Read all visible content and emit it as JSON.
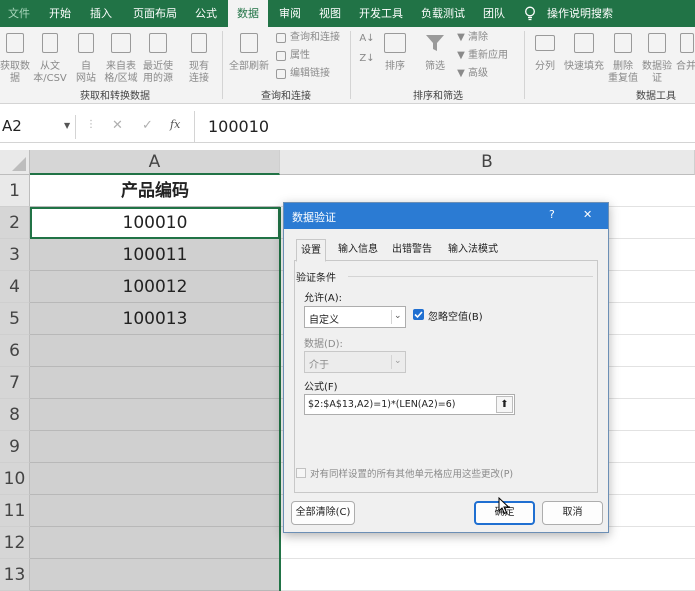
{
  "ribbon_tabs": [
    "文件",
    "开始",
    "插入",
    "页面布局",
    "公式",
    "数据",
    "审阅",
    "视图",
    "开发工具",
    "负载测试",
    "团队",
    "操作说明搜索"
  ],
  "active_tab": "数据",
  "ribbon": {
    "get_data": [
      "获取数",
      "据"
    ],
    "from_csv": [
      "从文",
      "本/CSV"
    ],
    "from_web": [
      "自",
      "网站"
    ],
    "from_table": [
      "来自表",
      "格/区域"
    ],
    "recent_sources": [
      "最近使",
      "用的源"
    ],
    "existing_conn": [
      "现有",
      "连接"
    ],
    "group1_label": "获取和转换数据",
    "refresh_all": [
      "全部刷新"
    ],
    "queries_conn": "查询和连接",
    "properties": "属性",
    "edit_links": "编辑链接",
    "group2_label": "查询和连接",
    "sort": "排序",
    "filter": "筛选",
    "clear": "清除",
    "reapply": "重新应用",
    "advanced": "高级",
    "group3_label": "排序和筛选",
    "text_to_columns": "分列",
    "flash_fill": "快速填充",
    "remove_dup": [
      "删除",
      "重复值"
    ],
    "data_validation": [
      "数据验",
      "证"
    ],
    "consolidate": "合并",
    "group4_label": "数据工具"
  },
  "formula_bar": {
    "name_box": "A2",
    "fx": "fx",
    "value": "100010"
  },
  "sheet": {
    "col_headers": [
      "A",
      "B"
    ],
    "row_numbers": [
      "1",
      "2",
      "3",
      "4",
      "5",
      "6",
      "7",
      "8",
      "9",
      "10",
      "11",
      "12",
      "13"
    ],
    "a_values": [
      "产品编码",
      "100010",
      "100011",
      "100012",
      "100013",
      "",
      "",
      "",
      "",
      "",
      "",
      "",
      ""
    ]
  },
  "dialog": {
    "title": "数据验证",
    "help": "?",
    "close": "✕",
    "tabs": [
      "设置",
      "输入信息",
      "出错警告",
      "输入法模式"
    ],
    "section": "验证条件",
    "allow_label": "允许(A):",
    "allow_value": "自定义",
    "ignore_blank": "忽略空值(B)",
    "data_label": "数据(D):",
    "data_value": "介于",
    "formula_label": "公式(F)",
    "formula_value": "$2:$A$13,A2)=1)*(LEN(A2)=6)",
    "apply_all": "对有同样设置的所有其他单元格应用这些更改(P)",
    "clear_all": "全部清除(C)",
    "ok": "确定",
    "cancel": "取消"
  },
  "colors": {
    "ribbon_green": "#217346",
    "dialog_blue": "#2b7bd3",
    "checkbox_blue": "#1f6fd1"
  }
}
